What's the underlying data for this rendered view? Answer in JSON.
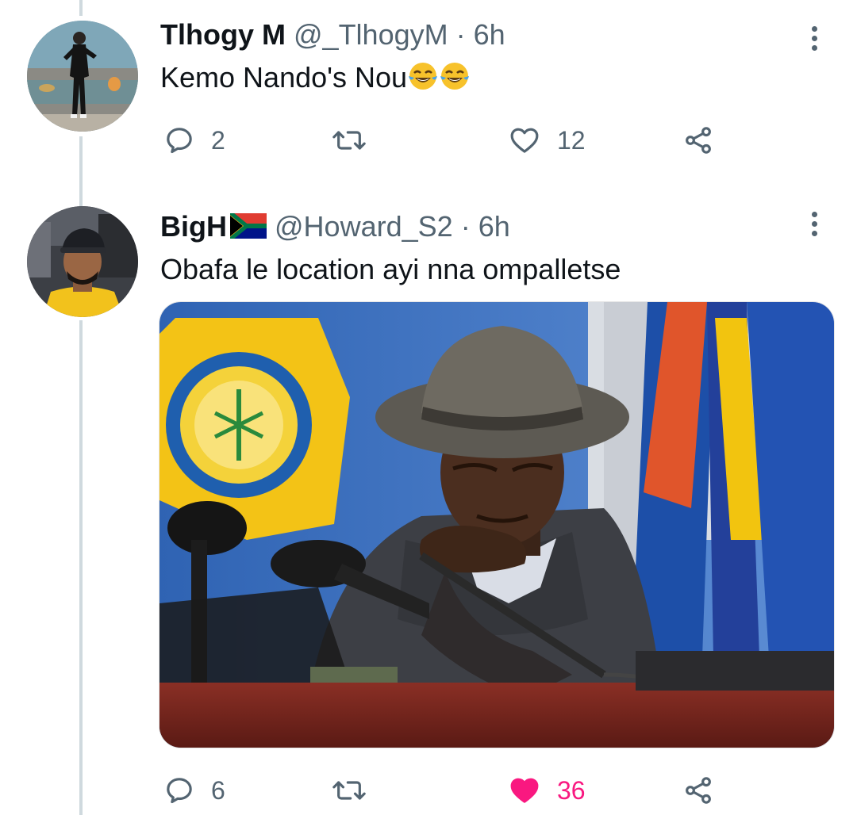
{
  "tweets": [
    {
      "display_name": "Tlhogy M",
      "handle": "@_TlhogyM",
      "separator": "·",
      "time": "6h",
      "text": "Kemo Nando's Nou",
      "emojis": [
        "face-with-tears-of-joy",
        "face-with-tears-of-joy"
      ],
      "actions": {
        "reply_count": "2",
        "retweet_count": "",
        "like_count": "12",
        "liked": false
      }
    },
    {
      "display_name": "BigH",
      "name_emoji": "south-africa-flag",
      "handle": "@Howard_S2",
      "separator": "·",
      "time": "6h",
      "text": "Obafa le location ayi nna ompalletse",
      "media": "photo",
      "actions": {
        "reply_count": "6",
        "retweet_count": "",
        "like_count": "36",
        "liked": true
      }
    }
  ],
  "colors": {
    "text_primary": "#0f1419",
    "text_secondary": "#536471",
    "like_active": "#f91880",
    "thread_line": "#cfd9de"
  },
  "icons": [
    "reply-icon",
    "retweet-icon",
    "like-icon",
    "share-icon",
    "more-icon"
  ]
}
